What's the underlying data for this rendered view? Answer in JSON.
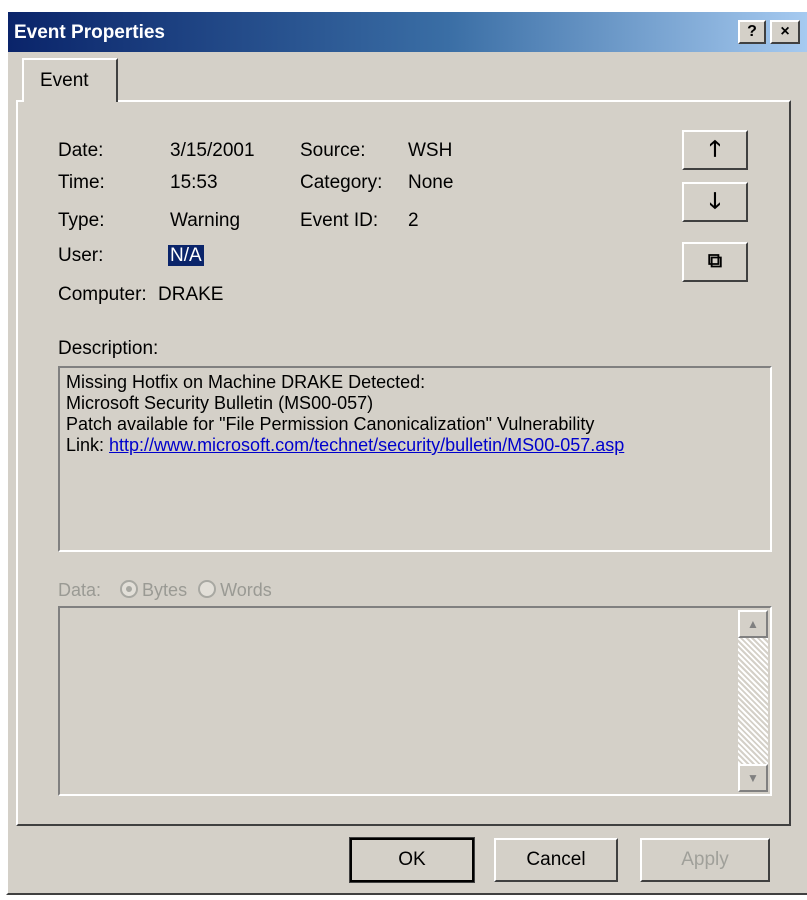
{
  "window": {
    "title": "Event Properties",
    "help_label": "?",
    "close_label": "×"
  },
  "tabs": [
    {
      "label": "Event"
    }
  ],
  "event": {
    "date_label": "Date:",
    "date_value": "3/15/2001",
    "time_label": "Time:",
    "time_value": "15:53",
    "type_label": "Type:",
    "type_value": "Warning",
    "user_label": "User:",
    "user_value": "N/A",
    "computer_label": "Computer:",
    "computer_value": "DRAKE",
    "source_label": "Source:",
    "source_value": "WSH",
    "category_label": "Category:",
    "category_value": "None",
    "eventid_label": "Event ID:",
    "eventid_value": "2"
  },
  "nav_buttons": {
    "up_icon": "arrow-up-icon",
    "up_glyph": "🡑",
    "down_icon": "arrow-down-icon",
    "down_glyph": "🡓",
    "copy_icon": "copy-icon",
    "copy_glyph": "⧉"
  },
  "description": {
    "label": "Description:",
    "lines": [
      "Missing Hotfix on Machine DRAKE Detected:",
      "Microsoft Security Bulletin (MS00-057)",
      "Patch available for \"File Permission Canonicalization\" Vulnerability"
    ],
    "link_prefix": "Link: ",
    "link_text": "http://www.microsoft.com/technet/security/bulletin/MS00-057.asp"
  },
  "data": {
    "label": "Data:",
    "bytes_label": "Bytes",
    "words_label": "Words",
    "selected": "Bytes"
  },
  "footer": {
    "ok_label": "OK",
    "cancel_label": "Cancel",
    "apply_label": "Apply"
  }
}
